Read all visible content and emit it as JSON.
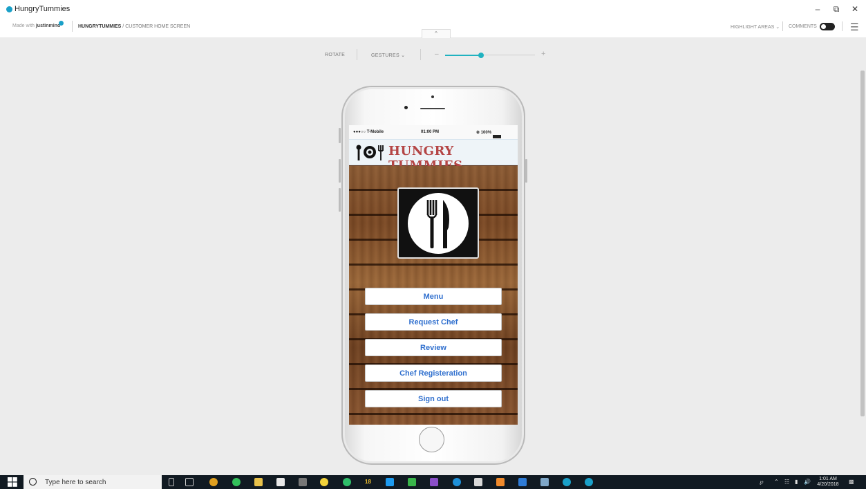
{
  "window": {
    "title": "HungryTummies",
    "controls": {
      "minimize": "–",
      "restore": "⧉",
      "close": "✕"
    }
  },
  "header": {
    "made_with_prefix": "Made with",
    "made_with_brand": "justinmind",
    "breadcrumb_project": "HUNGRYTUMMIES",
    "breadcrumb_sep": " / ",
    "breadcrumb_screen": "CUSTOMER HOME SCREEN",
    "highlight_areas": "HIGHLIGHT AREAS",
    "comments": "COMMENTS",
    "collapse_icon": "^"
  },
  "toolbar": {
    "rotate": "ROTATE",
    "gestures": "GESTURES",
    "zoom_minus": "–",
    "zoom_plus": "+",
    "zoom_level": 0.4
  },
  "phone": {
    "status": {
      "carrier": "●●●○○ T-Mobile",
      "time": "01:00 PM",
      "battery": "100%"
    },
    "app_title": "HUNGRY TUMMIES",
    "buttons": [
      "Menu",
      "Request Chef",
      "Review",
      "Chef Registeration",
      "Sign out"
    ]
  },
  "taskbar": {
    "search_placeholder": "Type here to search",
    "badge_number": "18",
    "clock_time": "1:01 AM",
    "clock_date": "4/20/2018"
  },
  "colors": {
    "accent": "#20b2c0",
    "brand": "#1aa0c8",
    "button_text": "#2f6fce",
    "title_red": "#b44545"
  }
}
